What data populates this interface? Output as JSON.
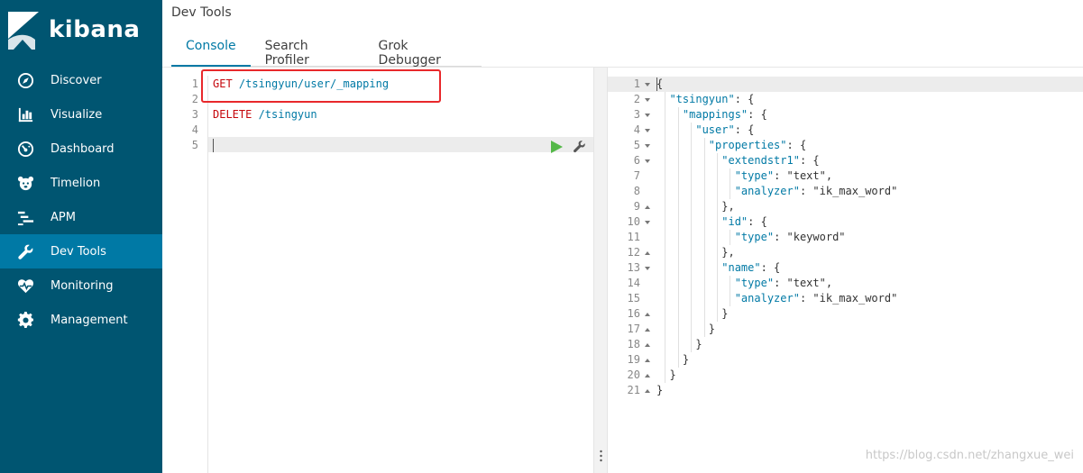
{
  "brand": {
    "name": "kibana"
  },
  "sidebar": {
    "items": [
      {
        "label": "Discover",
        "icon": "compass-icon",
        "active": false
      },
      {
        "label": "Visualize",
        "icon": "bar-chart-icon",
        "active": false
      },
      {
        "label": "Dashboard",
        "icon": "gauge-icon",
        "active": false
      },
      {
        "label": "Timelion",
        "icon": "timelion-icon",
        "active": false
      },
      {
        "label": "APM",
        "icon": "apm-icon",
        "active": false
      },
      {
        "label": "Dev Tools",
        "icon": "wrench-icon",
        "active": true
      },
      {
        "label": "Monitoring",
        "icon": "heartbeat-icon",
        "active": false
      },
      {
        "label": "Management",
        "icon": "gear-icon",
        "active": false
      }
    ]
  },
  "header": {
    "title": "Dev Tools",
    "tabs": [
      {
        "label": "Console",
        "active": true
      },
      {
        "label": "Search Profiler",
        "active": false
      },
      {
        "label": "Grok Debugger",
        "active": false
      }
    ]
  },
  "request_editor": {
    "lines": [
      {
        "n": "1",
        "method": "GET",
        "path": " /tsingyun/user/_mapping"
      },
      {
        "n": "2",
        "method": "",
        "path": ""
      },
      {
        "n": "3",
        "method": "DELETE",
        "path": " /tsingyun"
      },
      {
        "n": "4",
        "method": "",
        "path": ""
      },
      {
        "n": "5",
        "method": "",
        "path": ""
      }
    ]
  },
  "response_editor": {
    "lines": [
      {
        "n": "1",
        "fold": "down",
        "text": "{"
      },
      {
        "n": "2",
        "fold": "down",
        "text": "  \"tsingyun\": {"
      },
      {
        "n": "3",
        "fold": "down",
        "text": "    \"mappings\": {"
      },
      {
        "n": "4",
        "fold": "down",
        "text": "      \"user\": {"
      },
      {
        "n": "5",
        "fold": "down",
        "text": "        \"properties\": {"
      },
      {
        "n": "6",
        "fold": "down",
        "text": "          \"extendstr1\": {"
      },
      {
        "n": "7",
        "fold": "",
        "text": "            \"type\": \"text\","
      },
      {
        "n": "8",
        "fold": "",
        "text": "            \"analyzer\": \"ik_max_word\""
      },
      {
        "n": "9",
        "fold": "up",
        "text": "          },"
      },
      {
        "n": "10",
        "fold": "down",
        "text": "          \"id\": {"
      },
      {
        "n": "11",
        "fold": "",
        "text": "            \"type\": \"keyword\""
      },
      {
        "n": "12",
        "fold": "up",
        "text": "          },"
      },
      {
        "n": "13",
        "fold": "down",
        "text": "          \"name\": {"
      },
      {
        "n": "14",
        "fold": "",
        "text": "            \"type\": \"text\","
      },
      {
        "n": "15",
        "fold": "",
        "text": "            \"analyzer\": \"ik_max_word\""
      },
      {
        "n": "16",
        "fold": "up",
        "text": "          }"
      },
      {
        "n": "17",
        "fold": "up",
        "text": "        }"
      },
      {
        "n": "18",
        "fold": "up",
        "text": "      }"
      },
      {
        "n": "19",
        "fold": "up",
        "text": "    }"
      },
      {
        "n": "20",
        "fold": "up",
        "text": "  }"
      },
      {
        "n": "21",
        "fold": "up",
        "text": "}"
      }
    ]
  },
  "watermark": "https://blog.csdn.net/zhangxue_wei",
  "colors": {
    "sidebar_bg": "#005571",
    "sidebar_active": "#0079a5",
    "accent": "#0079a5",
    "method": "#c5060b",
    "highlight_box": "#e8282b",
    "run_button": "#54b848"
  }
}
